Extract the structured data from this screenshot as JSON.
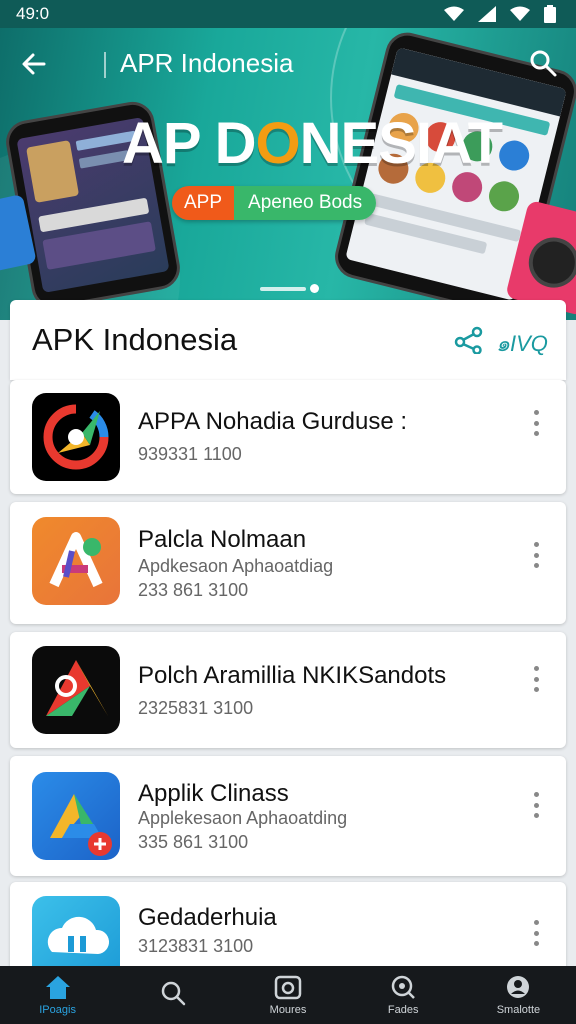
{
  "status": {
    "time": "49:0"
  },
  "appbar": {
    "title": "APR Indonesia"
  },
  "hero": {
    "headline_a": "AP D",
    "headline_o": "O",
    "headline_b": "NESIAT",
    "pill_left": "APP",
    "pill_right": "Apeneo Bods"
  },
  "section": {
    "title": "APK Indonesia",
    "tag": "๑IVQ"
  },
  "apps": [
    {
      "name": "APPA Nohadia Gurduse :",
      "subtitle": "",
      "number": "939331 1100"
    },
    {
      "name": "Palcla Nolmaan",
      "subtitle": "Apdkesaon Aphaoatdiag",
      "number": "233 861 3100"
    },
    {
      "name": "Polch Aramillia NKIKSandots",
      "subtitle": "",
      "number": "2325831 3100"
    },
    {
      "name": "Applik Clinass",
      "subtitle": "Applekesaon Aphaoatding",
      "number": "335 861 3100"
    },
    {
      "name": "Gedaderhuia",
      "subtitle": "",
      "number": "3123831 3100"
    }
  ],
  "nav": [
    {
      "label": "IPoagis",
      "icon": "home-icon"
    },
    {
      "label": "",
      "icon": "search-icon"
    },
    {
      "label": "Moures",
      "icon": "camera-icon"
    },
    {
      "label": "Fades",
      "icon": "discover-icon"
    },
    {
      "label": "Smalotte",
      "icon": "profile-icon"
    }
  ],
  "colors": {
    "accent": "#2aa3e0",
    "teal": "#19a89a",
    "orange": "#f05a1a",
    "green": "#39b76a"
  }
}
